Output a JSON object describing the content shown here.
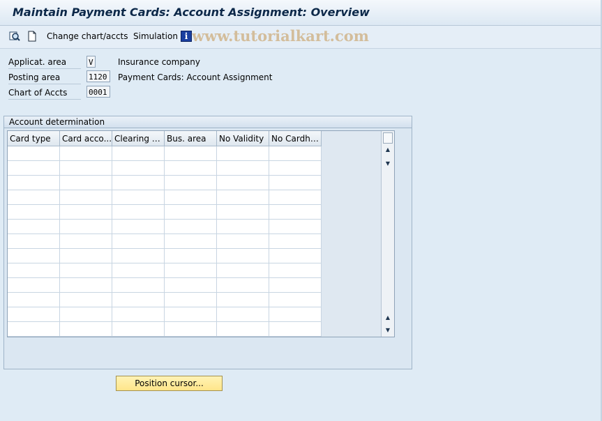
{
  "window": {
    "title": "Maintain Payment Cards: Account Assignment: Overview"
  },
  "toolbar": {
    "icons": [
      "find-icon",
      "new-entries-icon",
      "info-icon"
    ],
    "change_chart_label": "Change chart/accts",
    "simulation_label": "Simulation",
    "info_glyph": "i"
  },
  "watermark": "www.tutorialkart.com",
  "fields": [
    {
      "label": "Applicat. area",
      "value": "V",
      "description": "Insurance company"
    },
    {
      "label": "Posting area",
      "value": "1120",
      "description": "Payment Cards: Account Assignment"
    },
    {
      "label": "Chart of Accts",
      "value": "0001",
      "description": ""
    }
  ],
  "account_determination": {
    "title": "Account determination",
    "columns": [
      "Card type",
      "Card acco...",
      "Clearing ac...",
      "Bus. area",
      "No Validity",
      "No Cardho..."
    ],
    "rows": [
      [
        "",
        "",
        "",
        "",
        "",
        ""
      ],
      [
        "",
        "",
        "",
        "",
        "",
        ""
      ],
      [
        "",
        "",
        "",
        "",
        "",
        ""
      ],
      [
        "",
        "",
        "",
        "",
        "",
        ""
      ],
      [
        "",
        "",
        "",
        "",
        "",
        ""
      ],
      [
        "",
        "",
        "",
        "",
        "",
        ""
      ],
      [
        "",
        "",
        "",
        "",
        "",
        ""
      ],
      [
        "",
        "",
        "",
        "",
        "",
        ""
      ],
      [
        "",
        "",
        "",
        "",
        "",
        ""
      ],
      [
        "",
        "",
        "",
        "",
        "",
        ""
      ],
      [
        "",
        "",
        "",
        "",
        "",
        ""
      ],
      [
        "",
        "",
        "",
        "",
        "",
        ""
      ],
      [
        "",
        "",
        "",
        "",
        "",
        ""
      ]
    ]
  },
  "position_button_label": "Position cursor...",
  "colors": {
    "background": "#dfebf5",
    "title_text": "#0c2849",
    "button_yellow": "#ffe58a",
    "info_icon": "#1a3fa0"
  }
}
